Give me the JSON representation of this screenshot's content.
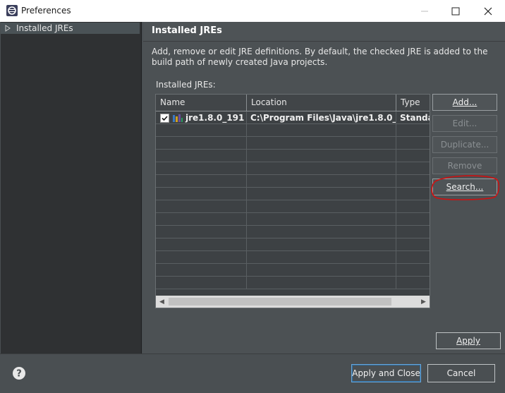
{
  "window": {
    "title": "Preferences"
  },
  "sidebar": {
    "items": [
      {
        "label": "Installed JREs"
      }
    ]
  },
  "page": {
    "title": "Installed JREs",
    "description": "Add, remove or edit JRE definitions. By default, the checked JRE is added to the build path of newly created Java projects.",
    "list_label": "Installed JREs:"
  },
  "table": {
    "columns": [
      "Name",
      "Location",
      "Type"
    ],
    "rows": [
      {
        "checked": true,
        "name": "jre1.8.0_191 ...",
        "location": "C:\\Program Files\\Java\\jre1.8.0_...",
        "type": "Standa"
      }
    ]
  },
  "buttons": {
    "add": "Add...",
    "edit": "Edit...",
    "duplicate": "Duplicate...",
    "remove": "Remove",
    "search": "Search...",
    "apply": "Apply"
  },
  "footer": {
    "apply_close": "Apply and Close",
    "cancel": "Cancel"
  },
  "colors": {
    "highlight_circle": "#d01010",
    "primary_border": "#6aa6d8"
  }
}
